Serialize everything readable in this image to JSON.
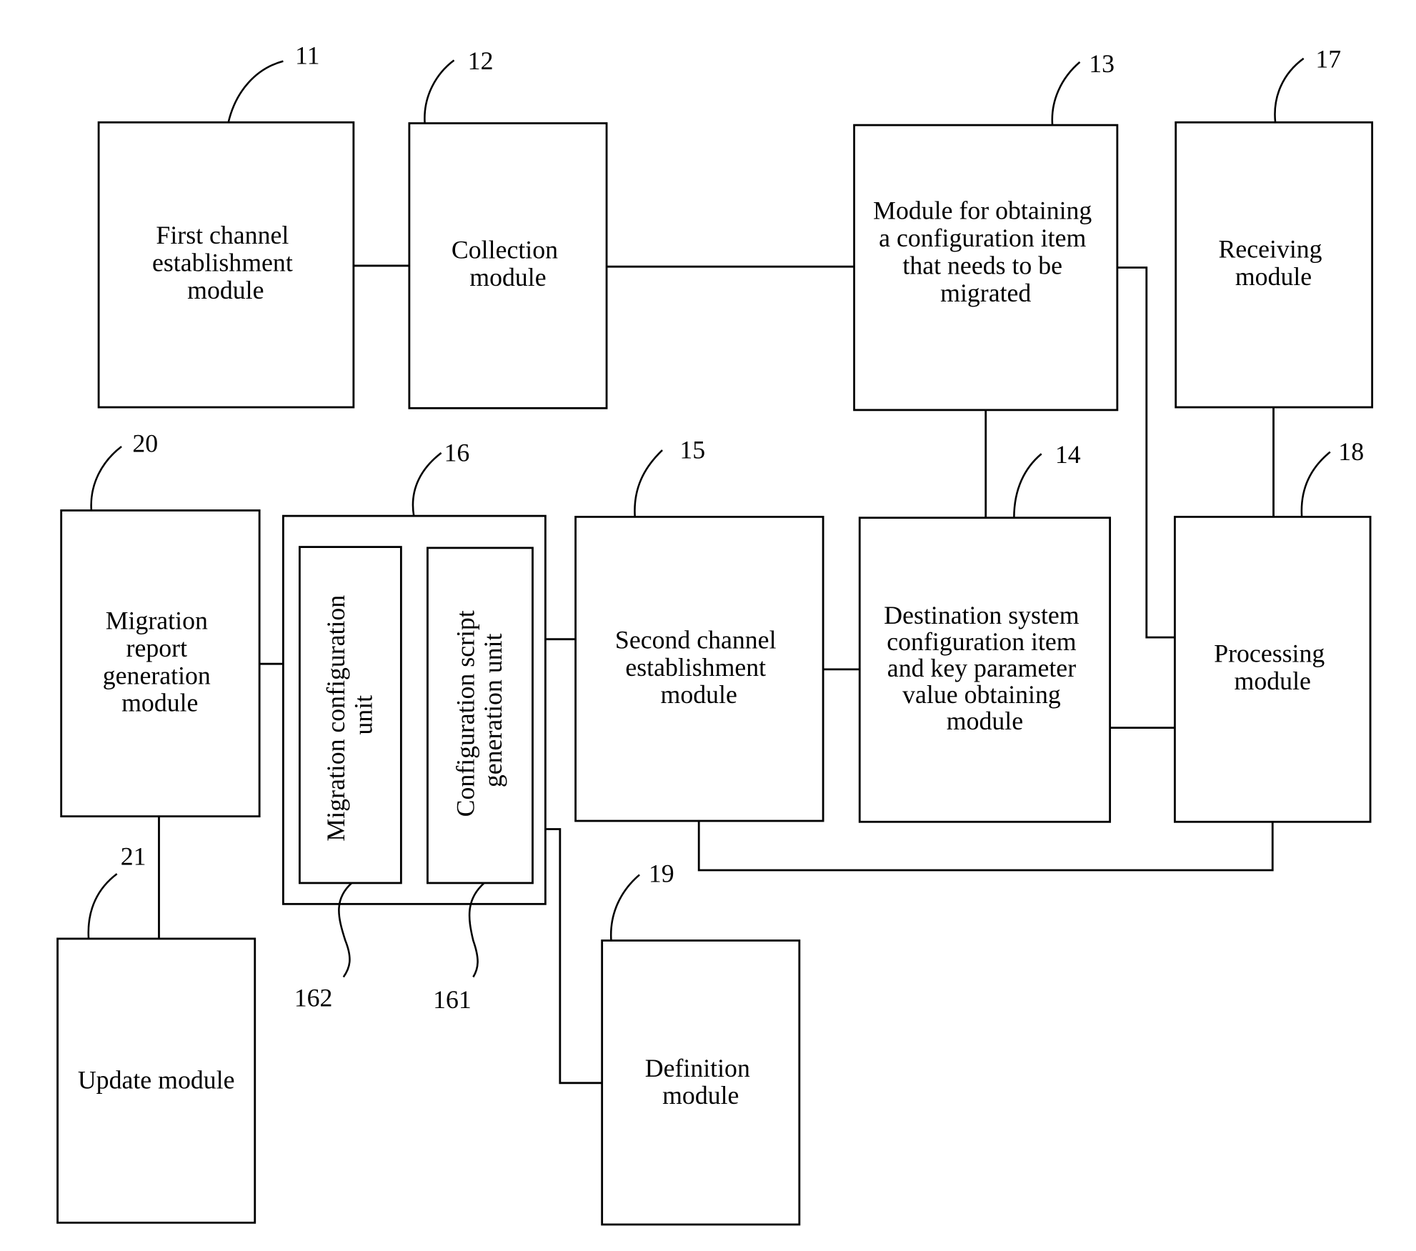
{
  "figure": {
    "modules": [
      {
        "ref": "11",
        "lines": [
          "First channel",
          "establishment",
          "module"
        ]
      },
      {
        "ref": "12",
        "lines": [
          "Collection",
          "module"
        ]
      },
      {
        "ref": "13",
        "lines": [
          "Module for obtaining",
          "a configuration item",
          "that needs to be",
          "migrated"
        ]
      },
      {
        "ref": "17",
        "lines": [
          "Receiving",
          "module"
        ]
      },
      {
        "ref": "20",
        "lines": [
          "Migration",
          "report",
          "generation",
          "module"
        ]
      },
      {
        "ref": "16",
        "lines": []
      },
      {
        "ref": "162",
        "lines": [
          "Migration configuration",
          "unit"
        ]
      },
      {
        "ref": "161",
        "lines": [
          "Configuration script",
          "generation unit"
        ]
      },
      {
        "ref": "15",
        "lines": [
          "Second channel",
          "establishment",
          "module"
        ]
      },
      {
        "ref": "14",
        "lines": [
          "Destination system",
          "configuration item",
          "and key parameter",
          "value obtaining",
          "module"
        ]
      },
      {
        "ref": "18",
        "lines": [
          "Processing",
          "module"
        ]
      },
      {
        "ref": "21",
        "lines": [
          "Update module"
        ]
      },
      {
        "ref": "19",
        "lines": [
          "Definition",
          "module"
        ]
      }
    ]
  }
}
